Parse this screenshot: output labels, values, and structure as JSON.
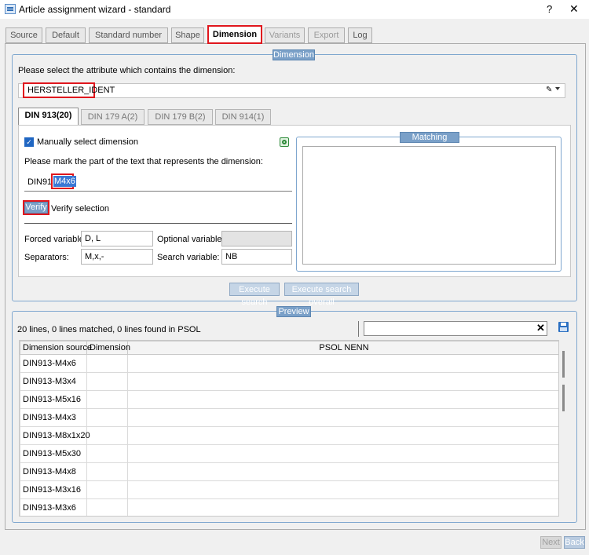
{
  "window": {
    "title": "Article assignment wizard - standard",
    "help_label": "?",
    "close_label": "✕"
  },
  "tabs": [
    "Source",
    "Default",
    "Standard number",
    "Shape",
    "Dimension",
    "Variants",
    "Export",
    "Log"
  ],
  "dimension_group": {
    "title": "Dimension",
    "prompt": "Please select the attribute which contains the dimension:",
    "attribute_value": "HERSTELLER_IDENT",
    "subtabs": [
      "DIN 913(20)",
      "DIN 179 A(2)",
      "DIN 179 B(2)",
      "DIN 914(1)"
    ],
    "manual_checkbox_label": "Manually select dimension",
    "mark_prompt": "Please mark the part of the text that represents the dimension:",
    "text_prefix": "DIN913-",
    "text_selected": "M4x6",
    "verify_button": "Verify",
    "verify_label": "Verify selection",
    "forced_label": "Forced variables:",
    "forced_value": "D, L",
    "optional_label": "Optional variables:",
    "optional_value": "",
    "separators_label": "Separators:",
    "separators_value": "M,x,-",
    "search_var_label": "Search variable:",
    "search_var_value": "NB",
    "matching_history_title": "Matching history",
    "execute_search": "Execute search",
    "execute_search_overall": "Execute search overall"
  },
  "preview_group": {
    "title": "Preview",
    "status": "20 lines, 0 lines matched, 0 lines found in PSOL",
    "search_value": "",
    "columns": [
      "Dimension source",
      "Dimension",
      "PSOL NENN"
    ],
    "rows": [
      [
        "DIN913-M4x6",
        "",
        ""
      ],
      [
        "DIN913-M3x4",
        "",
        ""
      ],
      [
        "DIN913-M5x16",
        "",
        ""
      ],
      [
        "DIN913-M4x3",
        "",
        ""
      ],
      [
        "DIN913-M8x1x20",
        "",
        ""
      ],
      [
        "DIN913-M5x30",
        "",
        ""
      ],
      [
        "DIN913-M4x8",
        "",
        ""
      ],
      [
        "DIN913-M3x16",
        "",
        ""
      ],
      [
        "DIN913-M3x6",
        "",
        ""
      ]
    ]
  },
  "footer": {
    "next": "Next",
    "back": "Back"
  },
  "colors": {
    "highlight": "#e0161d",
    "accent": "#7aa0c8",
    "selection": "#3a78d4"
  }
}
